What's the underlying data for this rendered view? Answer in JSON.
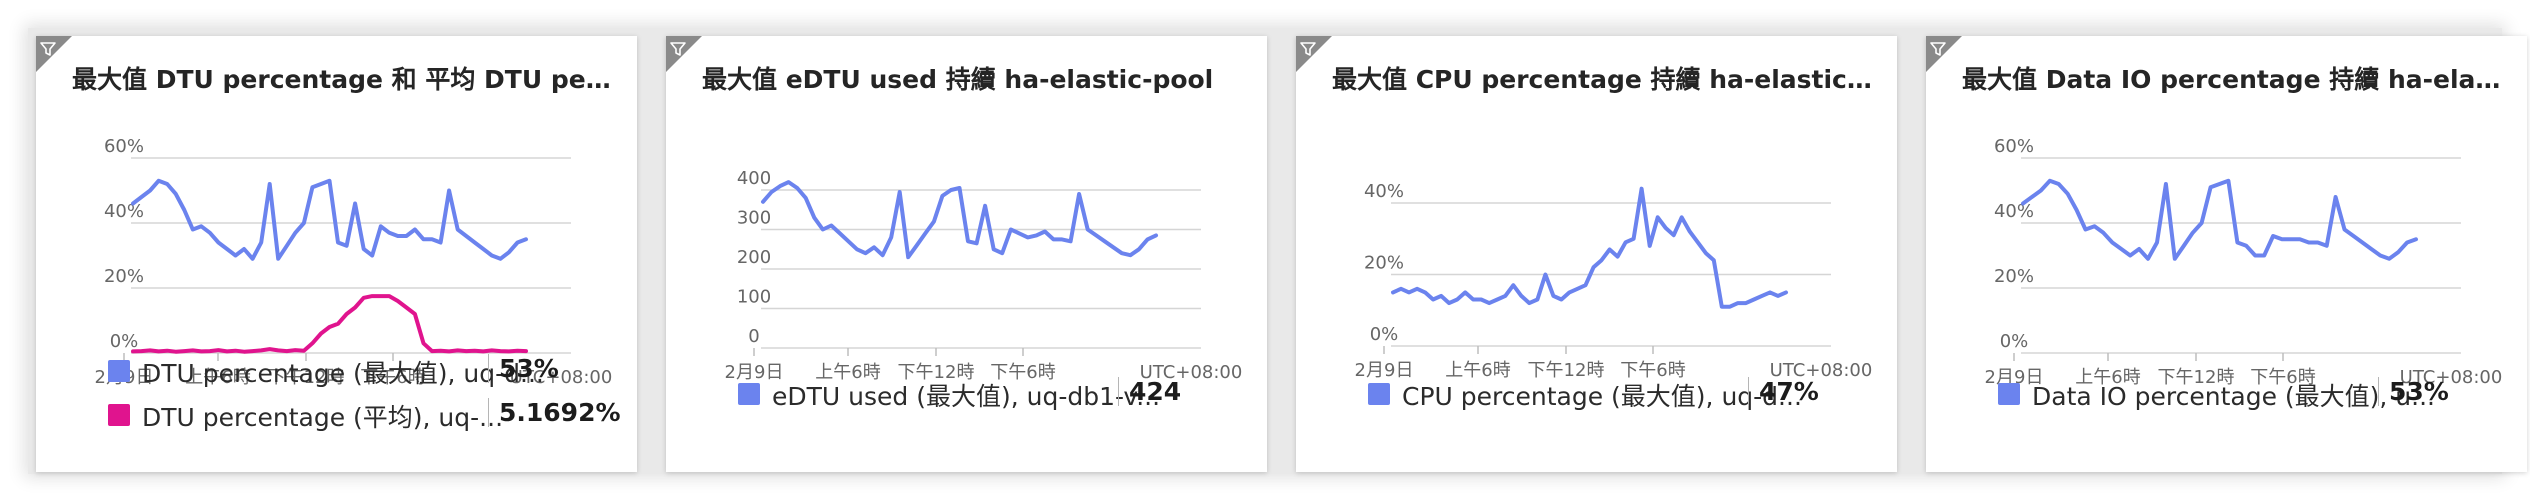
{
  "colors": {
    "series_blue": "#6b83ee",
    "series_pink": "#e0148e",
    "grid": "#d5d5d5",
    "axis_text": "#666666"
  },
  "icons": {
    "tile_corner": "filter-icon"
  },
  "tiles": [
    {
      "title": "最大值 DTU percentage 和 平均 DTU percen...",
      "legend": [
        {
          "label": "DTU percentage (最大值), uq-d...",
          "value": "53%",
          "color": "#6b83ee"
        },
        {
          "label": "DTU percentage (平均), uq-...",
          "value": "5.1692%",
          "color": "#e0148e"
        }
      ],
      "chart_data": {
        "type": "line",
        "ylim": [
          0,
          60
        ],
        "y_ticks": [
          "60%",
          "40%",
          "20%",
          "0%"
        ],
        "x_ticks": [
          "2月9日",
          "上午6時",
          "下午12時",
          "下午6時",
          "UTC+08:00"
        ],
        "series": [
          {
            "color": "#6b83ee",
            "values": [
              46,
              48,
              50,
              53,
              52,
              49,
              44,
              38,
              39,
              37,
              34,
              32,
              30,
              32,
              29,
              34,
              52,
              29,
              33,
              37,
              40,
              51,
              52,
              53,
              34,
              33,
              46,
              32,
              30,
              39,
              37,
              36,
              36,
              38,
              35,
              35,
              34,
              50,
              38,
              36,
              34,
              32,
              30,
              29,
              31,
              34,
              35
            ]
          },
          {
            "color": "#e0148e",
            "values": [
              0.5,
              0.6,
              0.8,
              0.5,
              0.7,
              0.4,
              0.6,
              0.8,
              0.5,
              0.6,
              0.9,
              0.5,
              0.7,
              0.4,
              0.6,
              0.8,
              1.2,
              0.8,
              0.6,
              0.9,
              0.7,
              3,
              6,
              8,
              9,
              12,
              14,
              17,
              17.5,
              17.5,
              17.5,
              16,
              14,
              12,
              3,
              0.6,
              0.7,
              0.5,
              0.8,
              0.6,
              0.7,
              0.5,
              0.8,
              0.6,
              0.5,
              0.7,
              0.6
            ]
          }
        ]
      }
    },
    {
      "title": "最大值 eDTU used 持續 ha-elastic-pool",
      "legend": [
        {
          "label": "eDTU used (最大值), uq-db1-v...",
          "value": "424",
          "color": "#6b83ee"
        }
      ],
      "chart_data": {
        "type": "line",
        "ylim": [
          0,
          400
        ],
        "y_ticks": [
          "400",
          "300",
          "200",
          "100",
          "0"
        ],
        "x_ticks": [
          "2月9日",
          "上午6時",
          "下午12時",
          "下午6時",
          "UTC+08:00"
        ],
        "series": [
          {
            "color": "#6b83ee",
            "values": [
              370,
              395,
              410,
              420,
              405,
              380,
              330,
              300,
              310,
              290,
              270,
              250,
              240,
              255,
              235,
              280,
              395,
              230,
              260,
              290,
              320,
              385,
              400,
              405,
              270,
              265,
              360,
              250,
              240,
              300,
              290,
              280,
              285,
              295,
              275,
              275,
              270,
              390,
              300,
              285,
              270,
              255,
              240,
              235,
              250,
              275,
              285
            ]
          }
        ]
      }
    },
    {
      "title": "最大值 CPU percentage 持續 ha-elastic-pool",
      "legend": [
        {
          "label": "CPU percentage (最大值), uq-d...",
          "value": "47%",
          "color": "#6b83ee"
        }
      ],
      "chart_data": {
        "type": "line",
        "ylim": [
          0,
          40
        ],
        "y_ticks": [
          "40%",
          "20%",
          "0%"
        ],
        "x_ticks": [
          "2月9日",
          "上午6時",
          "下午12時",
          "下午6時",
          "UTC+08:00"
        ],
        "series": [
          {
            "color": "#6b83ee",
            "values": [
              15,
              16,
              15,
              16,
              15,
              13,
              14,
              12,
              13,
              15,
              13,
              13,
              12,
              13,
              14,
              17,
              14,
              12,
              13,
              20,
              14,
              13,
              15,
              16,
              17,
              22,
              24,
              27,
              25,
              29,
              30,
              44,
              28,
              36,
              33,
              31,
              36,
              32,
              29,
              26,
              24,
              11,
              11,
              12,
              12,
              13,
              14,
              15,
              14,
              15
            ]
          }
        ]
      }
    },
    {
      "title": "最大值 Data IO percentage 持續 ha-elastic-...",
      "legend": [
        {
          "label": "Data IO percentage (最大值), u...",
          "value": "53%",
          "color": "#6b83ee"
        }
      ],
      "chart_data": {
        "type": "line",
        "ylim": [
          0,
          60
        ],
        "y_ticks": [
          "60%",
          "40%",
          "20%",
          "0%"
        ],
        "x_ticks": [
          "2月9日",
          "上午6時",
          "下午12時",
          "下午6時",
          "UTC+08:00"
        ],
        "series": [
          {
            "color": "#6b83ee",
            "values": [
              46,
              48,
              50,
              53,
              52,
              49,
              44,
              38,
              39,
              37,
              34,
              32,
              30,
              32,
              29,
              34,
              52,
              29,
              33,
              37,
              40,
              51,
              52,
              53,
              34,
              33,
              30,
              30,
              36,
              35,
              35,
              35,
              34,
              34,
              33,
              48,
              38,
              36,
              34,
              32,
              30,
              29,
              31,
              34,
              35
            ]
          }
        ]
      }
    }
  ]
}
